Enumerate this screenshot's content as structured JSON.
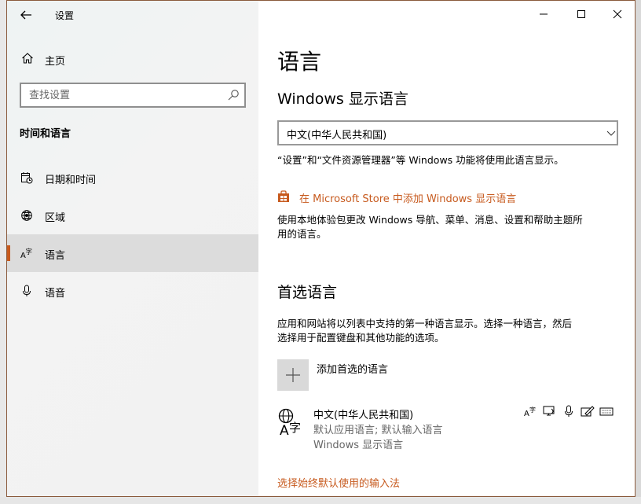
{
  "window": {
    "app_title": "设置",
    "controls": {
      "minimize": "—",
      "maximize": "☐",
      "close": "✕"
    }
  },
  "sidebar": {
    "home_label": "主页",
    "search_placeholder": "查找设置",
    "section_title": "时间和语言",
    "items": [
      {
        "label": "日期和时间",
        "icon": "calendar-clock-icon",
        "active": false
      },
      {
        "label": "区域",
        "icon": "globe-region-icon",
        "active": false
      },
      {
        "label": "语言",
        "icon": "language-icon",
        "active": true
      },
      {
        "label": "语音",
        "icon": "microphone-icon",
        "active": false
      }
    ]
  },
  "main": {
    "page_title": "语言",
    "display_language": {
      "heading": "Windows 显示语言",
      "selected": "中文(中华人民共和国)",
      "description": "“设置”和“文件资源管理器”等 Windows 功能将使用此语言显示。",
      "store_link": "在 Microsoft Store 中添加 Windows 显示语言",
      "store_description_line1": "使用本地体验包更改 Windows 导航、菜单、消息、设置和帮助主题所",
      "store_description_line2": "用的语言。"
    },
    "preferred_languages": {
      "heading": "首选语言",
      "description_line1": "应用和网站将以列表中支持的第一种语言显示。选择一种语言，然后",
      "description_line2": "选择用于配置键盘和其他功能的选项。",
      "add_label": "添加首选的语言",
      "languages": [
        {
          "name": "中文(中华人民共和国)",
          "sub1": "默认应用语言; 默认输入语言",
          "sub2": "Windows 显示语言"
        }
      ],
      "input_method_link": "选择始终默认使用的输入法"
    }
  },
  "colors": {
    "accent": "#c75a1e",
    "active_bg": "#dcdcdc",
    "secondary_text": "#666666"
  }
}
